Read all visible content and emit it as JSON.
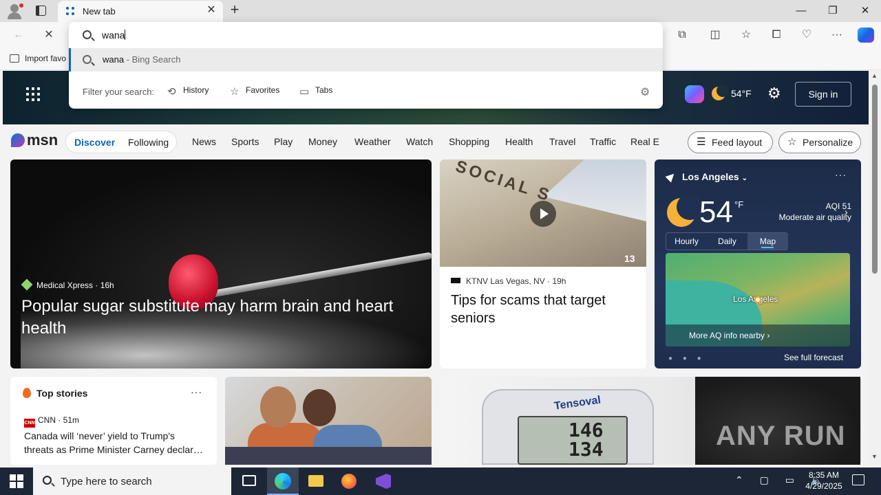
{
  "browser": {
    "tab_title": "New tab",
    "new_tab_symbol": "+",
    "close_symbol": "✕",
    "minimize_symbol": "—",
    "restore_symbol": "❐",
    "window_close_symbol": "✕",
    "favorites_bar_label": "Import favo",
    "address": {
      "typed_text": "wana",
      "suggestion_query": "wana",
      "suggestion_source": " - Bing Search",
      "filter_label": "Filter your search:",
      "filters": [
        "History",
        "Favorites",
        "Tabs"
      ]
    }
  },
  "msn": {
    "weather_temp_short": "54°F",
    "sign_in": "Sign in",
    "logo_text": "msn",
    "pill": [
      "Discover",
      "Following"
    ],
    "nav": [
      "News",
      "Sports",
      "Play",
      "Money",
      "Weather",
      "Watch",
      "Shopping",
      "Health",
      "Travel",
      "Traffic",
      "Real E"
    ],
    "feed_layout": "Feed layout",
    "personalize": "Personalize",
    "main_card": {
      "source": "Medical Xpress",
      "age": "16h",
      "title": "Popular sugar substitute may harm brain and heart health"
    },
    "second_card": {
      "source": "KTNV Las Vegas, NV",
      "age": "19h",
      "title": "Tips for scams that target seniors",
      "image_badge": "13"
    },
    "weather": {
      "location": "Los Angeles",
      "temp": "54",
      "unit": "°F",
      "aqi": "AQI 51",
      "aqi_desc": "Moderate air quality",
      "tabs": [
        "Hourly",
        "Daily",
        "Map"
      ],
      "selected_tab": "Map",
      "map_city": "Los Angeles",
      "more_aq": "More AQ info nearby ›",
      "full_forecast": "See full forecast",
      "more_symbol": "···"
    },
    "top_stories": {
      "heading": "Top stories",
      "source": "CNN",
      "age": "51m",
      "title": "Canada will ‘never’ yield to Trump's threats as Prime Minister Carney declar…",
      "more_symbol": "···"
    },
    "ad_card": {
      "brand": "Tensoval",
      "reading_sys": "146",
      "reading_dia": "134"
    },
    "watermark": "ANY RUN"
  },
  "taskbar": {
    "search_placeholder": "Type here to search",
    "time": "8:35 AM",
    "date": "4/29/2025"
  },
  "colors": {
    "accent": "#0a63b8",
    "taskbar": "#1c2636",
    "weather_card": "#1f3052"
  }
}
